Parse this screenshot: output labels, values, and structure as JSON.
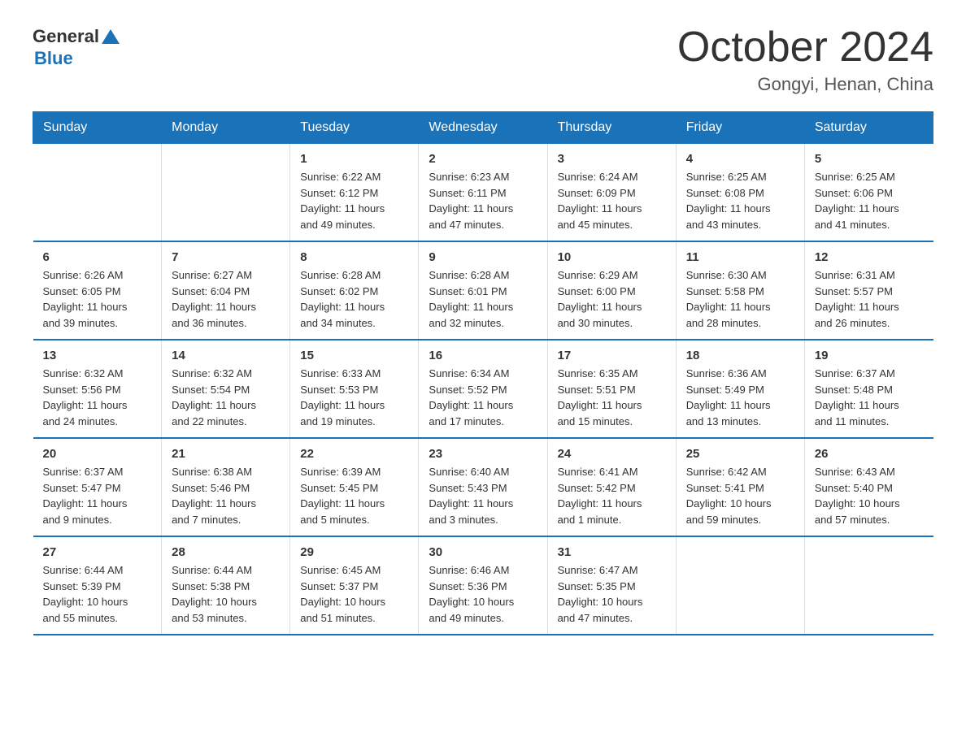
{
  "logo": {
    "general": "General",
    "triangle": "▲",
    "blue": "Blue"
  },
  "title": "October 2024",
  "location": "Gongyi, Henan, China",
  "days_of_week": [
    "Sunday",
    "Monday",
    "Tuesday",
    "Wednesday",
    "Thursday",
    "Friday",
    "Saturday"
  ],
  "weeks": [
    [
      {
        "day": "",
        "info": ""
      },
      {
        "day": "",
        "info": ""
      },
      {
        "day": "1",
        "info": "Sunrise: 6:22 AM\nSunset: 6:12 PM\nDaylight: 11 hours\nand 49 minutes."
      },
      {
        "day": "2",
        "info": "Sunrise: 6:23 AM\nSunset: 6:11 PM\nDaylight: 11 hours\nand 47 minutes."
      },
      {
        "day": "3",
        "info": "Sunrise: 6:24 AM\nSunset: 6:09 PM\nDaylight: 11 hours\nand 45 minutes."
      },
      {
        "day": "4",
        "info": "Sunrise: 6:25 AM\nSunset: 6:08 PM\nDaylight: 11 hours\nand 43 minutes."
      },
      {
        "day": "5",
        "info": "Sunrise: 6:25 AM\nSunset: 6:06 PM\nDaylight: 11 hours\nand 41 minutes."
      }
    ],
    [
      {
        "day": "6",
        "info": "Sunrise: 6:26 AM\nSunset: 6:05 PM\nDaylight: 11 hours\nand 39 minutes."
      },
      {
        "day": "7",
        "info": "Sunrise: 6:27 AM\nSunset: 6:04 PM\nDaylight: 11 hours\nand 36 minutes."
      },
      {
        "day": "8",
        "info": "Sunrise: 6:28 AM\nSunset: 6:02 PM\nDaylight: 11 hours\nand 34 minutes."
      },
      {
        "day": "9",
        "info": "Sunrise: 6:28 AM\nSunset: 6:01 PM\nDaylight: 11 hours\nand 32 minutes."
      },
      {
        "day": "10",
        "info": "Sunrise: 6:29 AM\nSunset: 6:00 PM\nDaylight: 11 hours\nand 30 minutes."
      },
      {
        "day": "11",
        "info": "Sunrise: 6:30 AM\nSunset: 5:58 PM\nDaylight: 11 hours\nand 28 minutes."
      },
      {
        "day": "12",
        "info": "Sunrise: 6:31 AM\nSunset: 5:57 PM\nDaylight: 11 hours\nand 26 minutes."
      }
    ],
    [
      {
        "day": "13",
        "info": "Sunrise: 6:32 AM\nSunset: 5:56 PM\nDaylight: 11 hours\nand 24 minutes."
      },
      {
        "day": "14",
        "info": "Sunrise: 6:32 AM\nSunset: 5:54 PM\nDaylight: 11 hours\nand 22 minutes."
      },
      {
        "day": "15",
        "info": "Sunrise: 6:33 AM\nSunset: 5:53 PM\nDaylight: 11 hours\nand 19 minutes."
      },
      {
        "day": "16",
        "info": "Sunrise: 6:34 AM\nSunset: 5:52 PM\nDaylight: 11 hours\nand 17 minutes."
      },
      {
        "day": "17",
        "info": "Sunrise: 6:35 AM\nSunset: 5:51 PM\nDaylight: 11 hours\nand 15 minutes."
      },
      {
        "day": "18",
        "info": "Sunrise: 6:36 AM\nSunset: 5:49 PM\nDaylight: 11 hours\nand 13 minutes."
      },
      {
        "day": "19",
        "info": "Sunrise: 6:37 AM\nSunset: 5:48 PM\nDaylight: 11 hours\nand 11 minutes."
      }
    ],
    [
      {
        "day": "20",
        "info": "Sunrise: 6:37 AM\nSunset: 5:47 PM\nDaylight: 11 hours\nand 9 minutes."
      },
      {
        "day": "21",
        "info": "Sunrise: 6:38 AM\nSunset: 5:46 PM\nDaylight: 11 hours\nand 7 minutes."
      },
      {
        "day": "22",
        "info": "Sunrise: 6:39 AM\nSunset: 5:45 PM\nDaylight: 11 hours\nand 5 minutes."
      },
      {
        "day": "23",
        "info": "Sunrise: 6:40 AM\nSunset: 5:43 PM\nDaylight: 11 hours\nand 3 minutes."
      },
      {
        "day": "24",
        "info": "Sunrise: 6:41 AM\nSunset: 5:42 PM\nDaylight: 11 hours\nand 1 minute."
      },
      {
        "day": "25",
        "info": "Sunrise: 6:42 AM\nSunset: 5:41 PM\nDaylight: 10 hours\nand 59 minutes."
      },
      {
        "day": "26",
        "info": "Sunrise: 6:43 AM\nSunset: 5:40 PM\nDaylight: 10 hours\nand 57 minutes."
      }
    ],
    [
      {
        "day": "27",
        "info": "Sunrise: 6:44 AM\nSunset: 5:39 PM\nDaylight: 10 hours\nand 55 minutes."
      },
      {
        "day": "28",
        "info": "Sunrise: 6:44 AM\nSunset: 5:38 PM\nDaylight: 10 hours\nand 53 minutes."
      },
      {
        "day": "29",
        "info": "Sunrise: 6:45 AM\nSunset: 5:37 PM\nDaylight: 10 hours\nand 51 minutes."
      },
      {
        "day": "30",
        "info": "Sunrise: 6:46 AM\nSunset: 5:36 PM\nDaylight: 10 hours\nand 49 minutes."
      },
      {
        "day": "31",
        "info": "Sunrise: 6:47 AM\nSunset: 5:35 PM\nDaylight: 10 hours\nand 47 minutes."
      },
      {
        "day": "",
        "info": ""
      },
      {
        "day": "",
        "info": ""
      }
    ]
  ]
}
